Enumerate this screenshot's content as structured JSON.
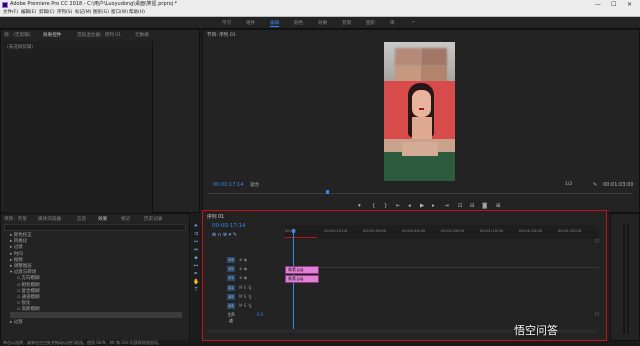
{
  "titlebar": {
    "title": "Adobe Premiere Pro CC 2018 - C:\\用户\\Luoyudong\\桌面\\笑星.prproj *",
    "minimize": "—",
    "maximize": "☐",
    "close": "✕"
  },
  "menu": [
    "文件(F)",
    "编辑(E)",
    "剪辑(C)",
    "序列(S)",
    "标记(M)",
    "图形(G)",
    "窗口(W)",
    "帮助(H)"
  ],
  "workspaces": {
    "items": [
      "学习",
      "组件",
      "编辑",
      "颜色",
      "效果",
      "音频",
      "图形",
      "库"
    ],
    "active": "编辑"
  },
  "source_panel": {
    "tabs": [
      "源：(无剪辑)",
      "效果控件",
      "音轨混合器：序列 01",
      "元数据"
    ],
    "active_tab": "效果控件",
    "empty_text": "(未选择剪辑)"
  },
  "program_panel": {
    "title": "节目: 序列 01",
    "timecode": "00:00:17:14",
    "fit": "适合",
    "quality": "1/2",
    "duration": "00:01:03:00"
  },
  "project_panel": {
    "tabs": [
      "项目：笑星",
      "媒体浏览器",
      "信息",
      "效果",
      "标记",
      "历史记录"
    ],
    "active_tab": "效果",
    "tree": [
      {
        "label": "颜色校正",
        "indent": 1,
        "open": false
      },
      {
        "label": "风格化",
        "indent": 1,
        "open": false
      },
      {
        "label": "过渡",
        "indent": 1,
        "open": false
      },
      {
        "label": "时间",
        "indent": 1,
        "open": false
      },
      {
        "label": "视频",
        "indent": 1,
        "open": false
      },
      {
        "label": "调整图层",
        "indent": 1,
        "open": false
      },
      {
        "label": "过渡与转场",
        "indent": 1,
        "open": true
      },
      {
        "label": "方向模糊",
        "indent": 2,
        "open": false
      },
      {
        "label": "相机模糊",
        "indent": 2,
        "open": false
      },
      {
        "label": "复合模糊",
        "indent": 2,
        "open": false
      },
      {
        "label": "通道模糊",
        "indent": 2,
        "open": false
      },
      {
        "label": "锐化",
        "indent": 2,
        "open": false
      },
      {
        "label": "高斯模糊",
        "indent": 2,
        "open": false
      },
      {
        "label": "生成",
        "indent": 1,
        "open": false
      },
      {
        "label": "过渡",
        "indent": 1,
        "open": false
      }
    ]
  },
  "timeline": {
    "tab": "序列 01",
    "timecode": "00:00:17:14",
    "ruler": [
      "00:00",
      "00:00:15:00",
      "00:00:30:00",
      "00:00:45:00",
      "00:01:00:00",
      "00:01:15:00",
      "00:01:30:00",
      "00:01:45:00"
    ],
    "tracks": [
      "V3",
      "V2",
      "V1",
      "A1",
      "A2",
      "A3",
      "主声道"
    ],
    "master_value": "0.0",
    "clips": [
      {
        "label": "像素.jpg",
        "track": "V2"
      },
      {
        "label": "像素.jpg",
        "track": "V1"
      }
    ]
  },
  "status": {
    "text": "单击以选择，或单击空白处并拖动以进行框选。使用 Shift、Alt 和 Ctrl 可获得其他选项。"
  },
  "watermark": "悟空问答",
  "colors": {
    "accent": "#2d8ceb",
    "clip": "#e27fd6",
    "highlight": "#c0141c"
  }
}
